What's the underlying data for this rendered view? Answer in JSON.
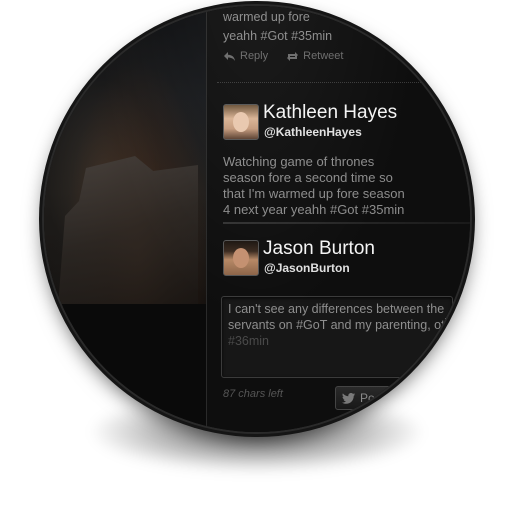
{
  "previous_tweet": {
    "text_lines": [
      "warmed up fore",
      "yeahh #Got #35min"
    ],
    "actions": {
      "reply": "Reply",
      "retweet": "Retweet"
    }
  },
  "feed": [
    {
      "name": "Kathleen Hayes",
      "handle": "@KathleenHayes",
      "text": "Watching game of thrones season fore a second time so that I'm warmed up fore season 4 next year yeahh #Got #35min"
    }
  ],
  "composer": {
    "name": "Jason Burton",
    "handle": "@JasonBurton",
    "draft_text": "I can't see any differences between the servants on #GoT and my parenting, ot",
    "draft_suffix": " #36min",
    "chars_left": "87 chars left",
    "post_label": "Pos"
  }
}
